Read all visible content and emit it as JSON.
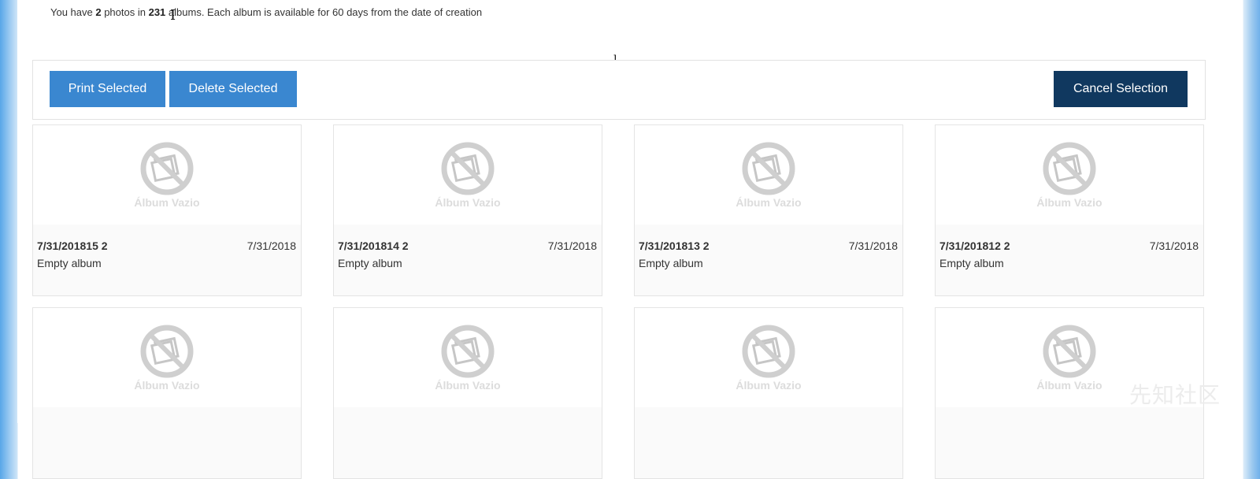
{
  "info": {
    "prefix": "You have ",
    "photo_count": "2",
    "middle": " photos in ",
    "album_count": "231",
    "suffix": " albums. Each album is available for 60 days from the date of creation"
  },
  "toolbar": {
    "print_label": "Print Selected",
    "delete_label": "Delete Selected",
    "cancel_label": "Cancel Selection"
  },
  "placeholder_caption": "Álbum Vazio",
  "albums": [
    {
      "title": "7/31/201815 2",
      "date": "7/31/2018",
      "status": "Empty album"
    },
    {
      "title": "7/31/201814 2",
      "date": "7/31/2018",
      "status": "Empty album"
    },
    {
      "title": "7/31/201813 2",
      "date": "7/31/2018",
      "status": "Empty album"
    },
    {
      "title": "7/31/201812 2",
      "date": "7/31/2018",
      "status": "Empty album"
    },
    {
      "title": "",
      "date": "",
      "status": ""
    },
    {
      "title": "",
      "date": "",
      "status": ""
    },
    {
      "title": "",
      "date": "",
      "status": ""
    },
    {
      "title": "",
      "date": "",
      "status": ""
    }
  ],
  "watermark": "先知社区",
  "colors": {
    "primary_button": "#3a87d0",
    "dark_button": "#10385f"
  },
  "icons": {
    "empty_album": "no-photo-icon"
  }
}
